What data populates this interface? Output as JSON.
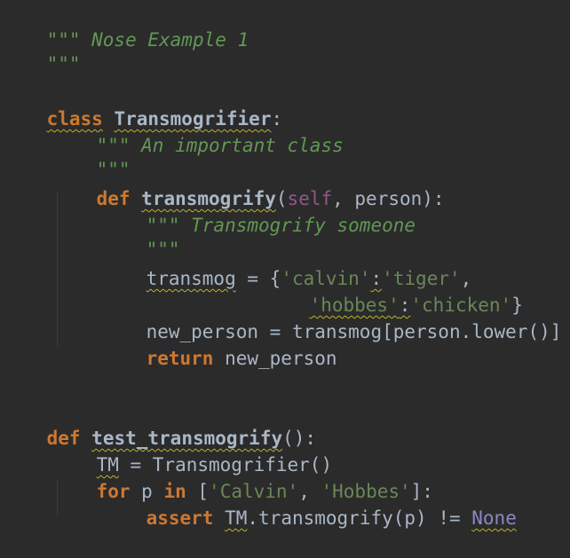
{
  "editor": {
    "lines": {
      "l1_doc": "\"\"\" Nose Example 1",
      "l2_doc": "\"\"\"",
      "l4_kw": "class",
      "l4_name": "Transmogrifier",
      "l4_colon": ":",
      "l5_doc": "\"\"\" An important class",
      "l6_doc": "\"\"\"",
      "l7_kw": "def",
      "l7_name": "transmogrify",
      "l7_open": "(",
      "l7_self": "self",
      "l7_rest": ", person):",
      "l8_doc": "\"\"\" Transmogrify someone",
      "l9_doc": "\"\"\"",
      "l10_var": "transmog",
      "l10_eq": " = {",
      "l10_s1": "'calvin'",
      "l10_colon": ":",
      "l10_s2": "'tiger'",
      "l10_comma": ",",
      "l11_s1": "'hobbes'",
      "l11_colon": ":",
      "l11_s2": "'chicken'",
      "l11_close": "}",
      "l12_code": "new_person = transmog[person.lower()]",
      "l13_kw": "return",
      "l13_rest": " new_person",
      "l16_kw": "def",
      "l16_name": "test_transmogrify",
      "l16_rest": "():",
      "l17_var": "TM",
      "l17_rest": " = Transmogrifier()",
      "l18_kw1": "for",
      "l18_mid1": " p ",
      "l18_kw2": "in",
      "l18_mid2": " [",
      "l18_s1": "'Calvin'",
      "l18_mid3": ", ",
      "l18_s2": "'Hobbes'",
      "l18_end": "]:",
      "l19_kw": "assert",
      "l19_sp": " ",
      "l19_tm": "TM",
      "l19_rest": ".transmogrify(p) != ",
      "l19_none": "None"
    }
  },
  "colors": {
    "background": "#2b2b2b",
    "keyword": "#cc7832",
    "docstring": "#629755",
    "string": "#6a8759",
    "self": "#94558d",
    "none": "#8888c6",
    "text": "#a9b7c6",
    "warning_underline": "#bbb529"
  }
}
